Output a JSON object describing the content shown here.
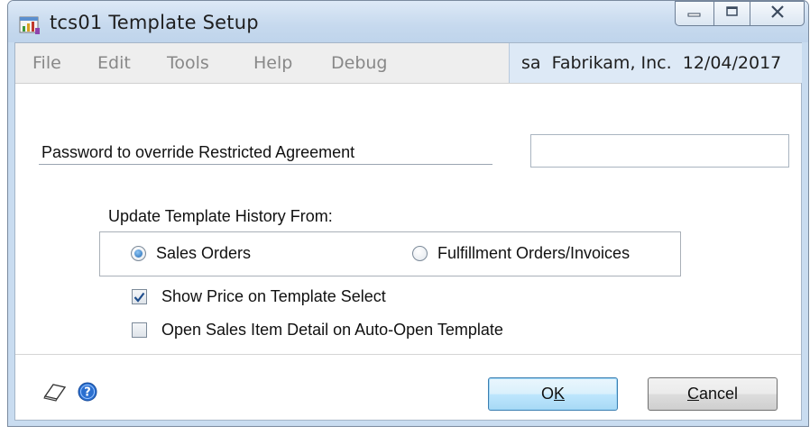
{
  "window": {
    "title": "tcs01 Template Setup",
    "icon": "template-setup-app-icon",
    "controls": [
      "minimize-icon",
      "maximize-icon",
      "close-icon"
    ]
  },
  "menu": {
    "items": [
      "File",
      "Edit",
      "Tools",
      "Help",
      "Debug"
    ],
    "user": "sa",
    "company": "Fabrikam, Inc.",
    "date": "12/04/2017"
  },
  "form": {
    "password_label": "Password to override Restricted Agreement",
    "password_value": "",
    "history_group_label": "Update Template History From:",
    "radios": [
      {
        "label": "Sales Orders",
        "selected": true
      },
      {
        "label": "Fulfillment Orders/Invoices",
        "selected": false
      }
    ],
    "checkboxes": [
      {
        "label": "Show Price on Template Select",
        "checked": true
      },
      {
        "label": "Open Sales Item Detail on Auto-Open Template",
        "checked": false
      }
    ]
  },
  "footer": {
    "note_icon": "note-icon",
    "help_icon": "help-icon",
    "ok_prefix": "O",
    "ok_accel": "K",
    "cancel_accel": "C",
    "cancel_rest": "ancel"
  },
  "colors": {
    "title_bar": "#c6d9ee",
    "info_panel": "#dde9f6",
    "menu_text_disabled": "#888888",
    "default_button": "#bee6fd"
  }
}
